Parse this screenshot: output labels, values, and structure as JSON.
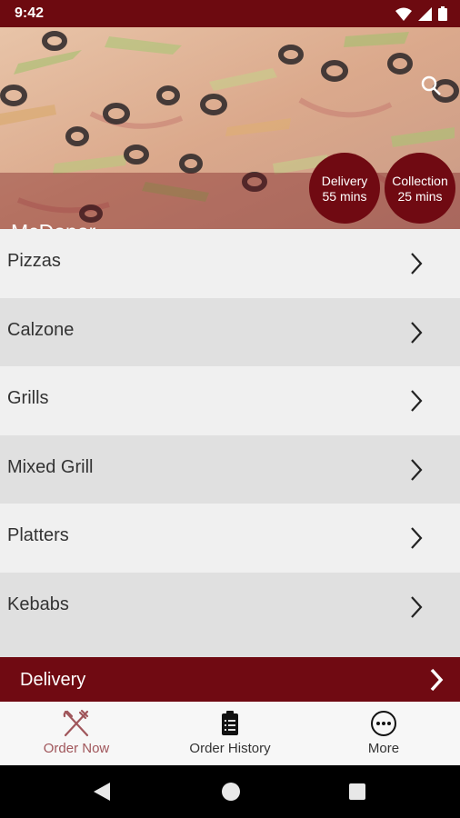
{
  "status_bar": {
    "time": "9:42",
    "icons": [
      "wifi-icon",
      "signal-icon",
      "battery-icon"
    ]
  },
  "hero": {
    "restaurant_name": "McDoner",
    "search_icon": "search-icon",
    "delivery_badge": {
      "title": "Delivery",
      "time": "55 mins"
    },
    "collection_badge": {
      "title": "Collection",
      "time": "25 mins"
    }
  },
  "menu": {
    "items": [
      {
        "label": "Pizzas"
      },
      {
        "label": "Calzone"
      },
      {
        "label": "Grills"
      },
      {
        "label": "Mixed Grill"
      },
      {
        "label": "Platters"
      },
      {
        "label": "Kebabs"
      }
    ],
    "row_icon": "chevron-right-icon"
  },
  "delivery_bar": {
    "label": "Delivery",
    "icon": "chevron-right-icon"
  },
  "bottom_nav": {
    "items": [
      {
        "label": "Order Now",
        "icon": "fork-knife-icon",
        "active": true
      },
      {
        "label": "Order History",
        "icon": "clipboard-icon",
        "active": false
      },
      {
        "label": "More",
        "icon": "more-icon",
        "active": false
      }
    ]
  },
  "system_nav": {
    "icons": [
      "back-icon",
      "home-icon",
      "recents-icon"
    ]
  },
  "colors": {
    "brand": "#700a12",
    "status_bar": "#6d0a10",
    "active_nav": "#a0565b",
    "row_light": "#f0f0f0",
    "row_dark": "#e0e0e0"
  }
}
